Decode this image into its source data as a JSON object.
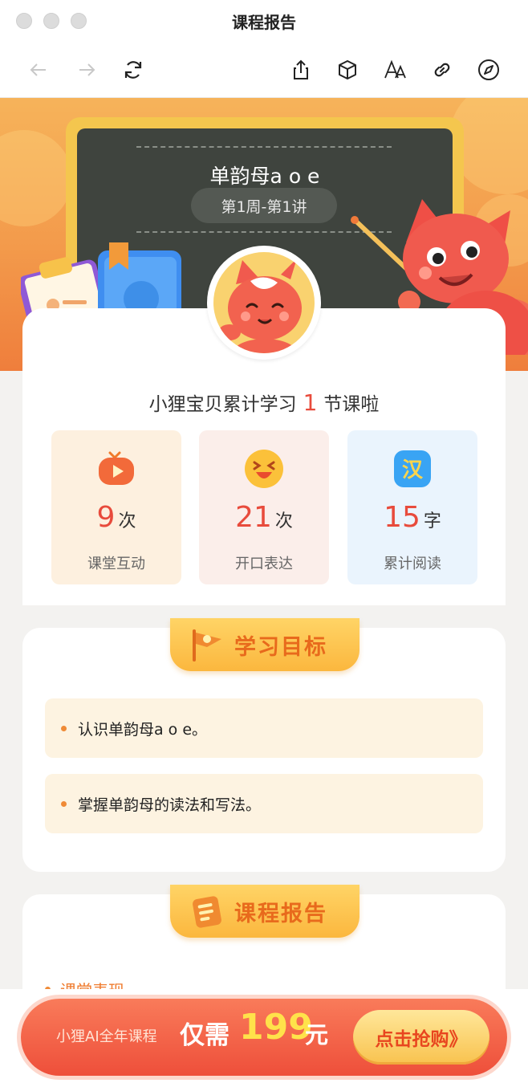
{
  "window": {
    "title": "课程报告"
  },
  "hero": {
    "lesson_title": "单韵母a o e",
    "week": "第1周-第1讲"
  },
  "summary": {
    "headline_prefix": "小狸宝贝累计学习",
    "headline_count": "1",
    "headline_suffix": "节课啦",
    "stats": [
      {
        "value": "9",
        "unit": "次",
        "label": "课堂互动",
        "icon": "video-icon",
        "bg": "#fdf0df"
      },
      {
        "value": "21",
        "unit": "次",
        "label": "开口表达",
        "icon": "laughing-face-icon",
        "bg": "#fbeeea"
      },
      {
        "value": "15",
        "unit": "字",
        "label": "累计阅读",
        "icon": "han-character-icon",
        "glyph": "汉",
        "bg": "#eaf4fd"
      }
    ]
  },
  "goals": {
    "title": "学习目标",
    "items": [
      "认识单韵母a o e。",
      "掌握单韵母的读法和写法。"
    ]
  },
  "report": {
    "title": "课程报告",
    "section": "课堂表现"
  },
  "promo": {
    "prefix": "小狸AI全年课程",
    "only": "仅需",
    "price": "199",
    "currency": "元",
    "button": "点击抢购》"
  },
  "colors": {
    "accent": "#e84b3c",
    "orange": "#ef8a36",
    "board": "#3f443e"
  }
}
